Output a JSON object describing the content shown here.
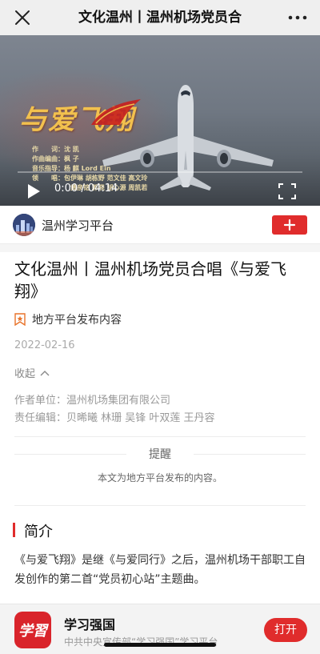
{
  "nav": {
    "title": "文化温州丨温州机场党员合",
    "close_icon": "close-icon",
    "more_icon": "more-dots-icon"
  },
  "video": {
    "logo_text": "与爱飞翔",
    "credits": [
      {
        "role": "作　　词：",
        "name": "沈 凯"
      },
      {
        "role": "作曲编曲：",
        "name": "枫 子"
      },
      {
        "role": "音乐指导：",
        "name": "杨 麒 Lord Ein"
      },
      {
        "role": "领　　唱：",
        "name": "包伊琳 胡栋野 范文佳 高文玲"
      },
      {
        "role": "",
        "name": "黄彦铭 郭晓 胡心源 周凯若"
      }
    ],
    "current_time": "0:00",
    "duration": "04:14",
    "time_separator": " / ",
    "progress": 0.0
  },
  "account": {
    "name": "温州学习平台",
    "follow_icon": "plus-icon"
  },
  "article": {
    "title": "文化温州丨温州机场党员合唱《与爱飞翔》",
    "source_label": "地方平台发布内容",
    "date": "2022-02-16",
    "collapse_label": "收起",
    "author_label": "作者单位：",
    "author_value": "温州机场集团有限公司",
    "editor_label": "责任编辑：",
    "editor_value": "贝晞曦 林珊 吴锋 叶双莲 王丹容",
    "notice_title": "提醒",
    "notice_body": "本文为地方平台发布的内容。",
    "section_title": "简介",
    "intro": "《与爱飞翔》是继《与爱同行》之后，温州机场干部职工自发创作的第二首“党员初心站”主题曲。"
  },
  "app_banner": {
    "icon_text": "学習",
    "name": "学习强国",
    "desc": "中共中央宣传部“学习强国”学习平台",
    "open_label": "打开"
  },
  "colors": {
    "accent_red": "#e02c2c",
    "nav_bg": "#efefef",
    "logo_gold": "#f2c14e"
  }
}
